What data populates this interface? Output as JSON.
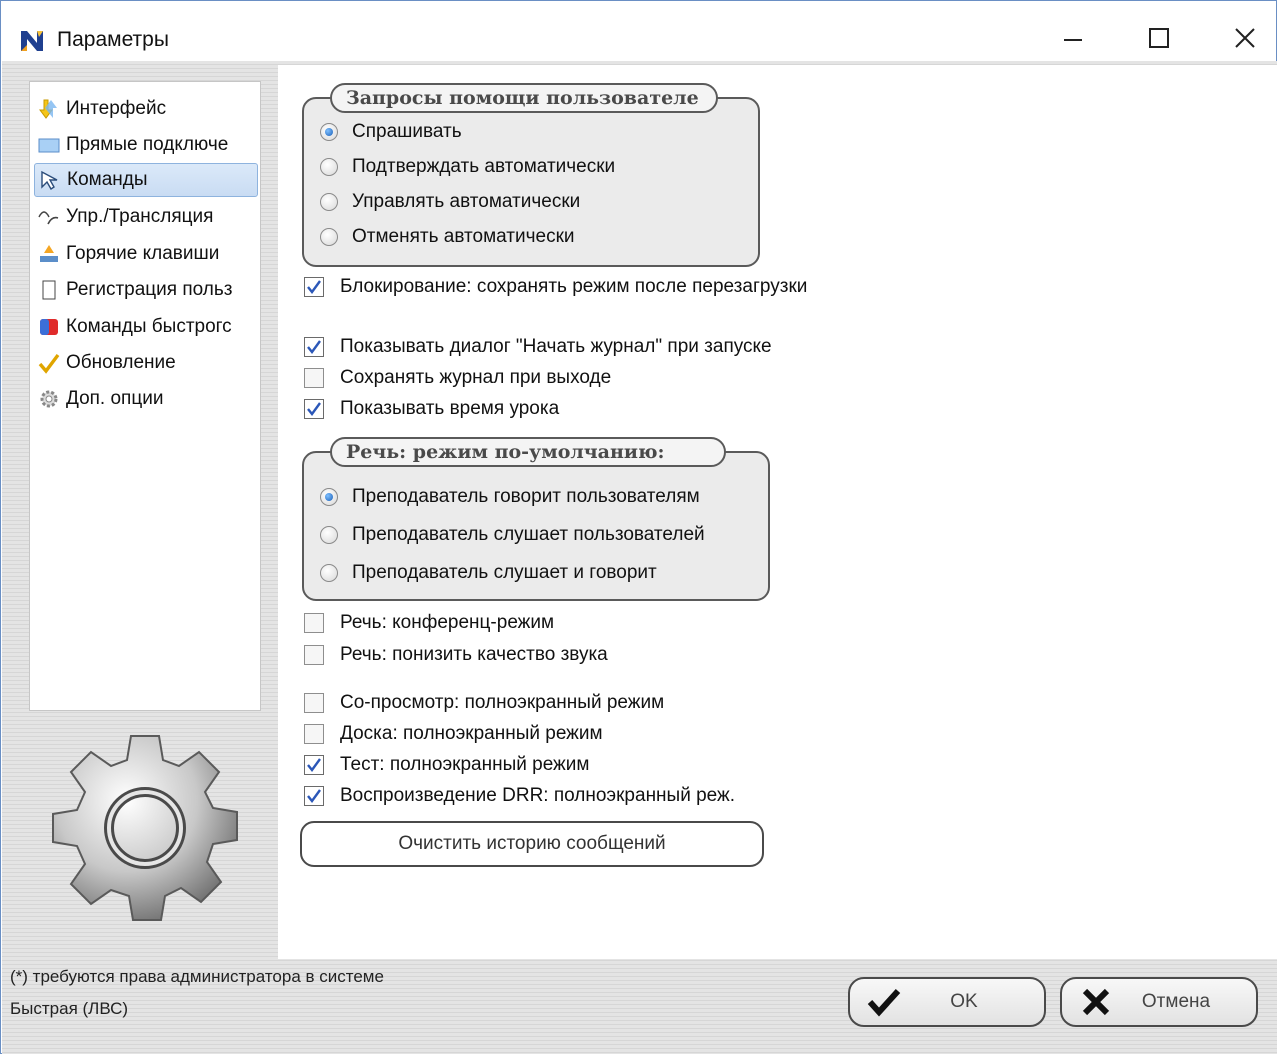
{
  "window": {
    "title": "Параметры"
  },
  "nav": {
    "items": [
      {
        "label": "Интерфейс",
        "icon": "interface-arrows-icon"
      },
      {
        "label": "Прямые подключе",
        "icon": "monitor-icon"
      },
      {
        "label": "Команды",
        "icon": "cursor-icon",
        "selected": true
      },
      {
        "label": "Упр./Трансляция",
        "icon": "broadcast-icon"
      },
      {
        "label": "Горячие клавиши",
        "icon": "hotkey-icon"
      },
      {
        "label": "Регистрация польз",
        "icon": "registration-icon"
      },
      {
        "label": "Команды быстрогс",
        "icon": "quick-commands-icon"
      },
      {
        "label": "Обновление",
        "icon": "checkmark-icon"
      },
      {
        "label": "Доп. опции",
        "icon": "gear-small-icon"
      }
    ]
  },
  "help_requests": {
    "legend": "Запросы помощи пользователе",
    "options": [
      {
        "label": "Спрашивать",
        "selected": true
      },
      {
        "label": "Подтверждать автоматически",
        "selected": false
      },
      {
        "label": "Управлять автоматически",
        "selected": false
      },
      {
        "label": "Отменять автоматически",
        "selected": false
      }
    ]
  },
  "checks_a": [
    {
      "label": "Блокирование: сохранять режим после перезагрузки",
      "checked": true
    }
  ],
  "checks_b": [
    {
      "label": "Показывать диалог \"Начать журнал\" при запуске",
      "checked": true
    },
    {
      "label": "Сохранять журнал при выходе",
      "checked": false
    },
    {
      "label": "Показывать время урока",
      "checked": true
    }
  ],
  "speech": {
    "legend": "Речь: режим по-умолчанию:",
    "options": [
      {
        "label": "Преподаватель говорит пользователям",
        "selected": true
      },
      {
        "label": "Преподаватель слушает пользователей",
        "selected": false
      },
      {
        "label": "Преподаватель слушает и говорит",
        "selected": false
      }
    ]
  },
  "checks_c": [
    {
      "label": "Речь: конференц-режим",
      "checked": false
    },
    {
      "label": "Речь: понизить качество звука",
      "checked": false
    }
  ],
  "checks_d": [
    {
      "label": "Со-просмотр: полноэкранный режим",
      "checked": false
    },
    {
      "label": "Доска: полноэкранный режим",
      "checked": false
    },
    {
      "label": "Тест: полноэкранный режим",
      "checked": true
    },
    {
      "label": "Воспроизведение DRR: полноэкранный реж.",
      "checked": true
    }
  ],
  "clear_history_label": "Очистить историю сообщений",
  "footer": {
    "admin_note": "(*) требуются права администратора в системе",
    "mode": "Быстрая (ЛВС)",
    "ok_label": "OK",
    "cancel_label": "Отмена"
  }
}
